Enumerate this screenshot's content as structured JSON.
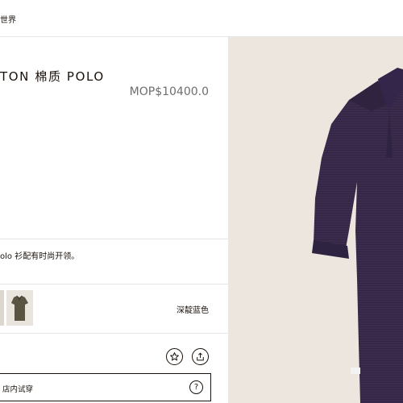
{
  "header": {
    "breadcrumb": "世界"
  },
  "product": {
    "title": "TON 棉质 POLO",
    "price": "MOP$10400.0",
    "description": "olo 衫配有时尚开领。",
    "selected_color": "深靛蓝色",
    "colors": {
      "purple": "#3a2a4e",
      "olive": "#5a5543",
      "background": "#ede6df"
    }
  },
  "actions": {
    "wishlist_icon": "star-icon",
    "share_icon": "share-icon",
    "try_on_label": "店内试穿",
    "help_label": "?"
  }
}
